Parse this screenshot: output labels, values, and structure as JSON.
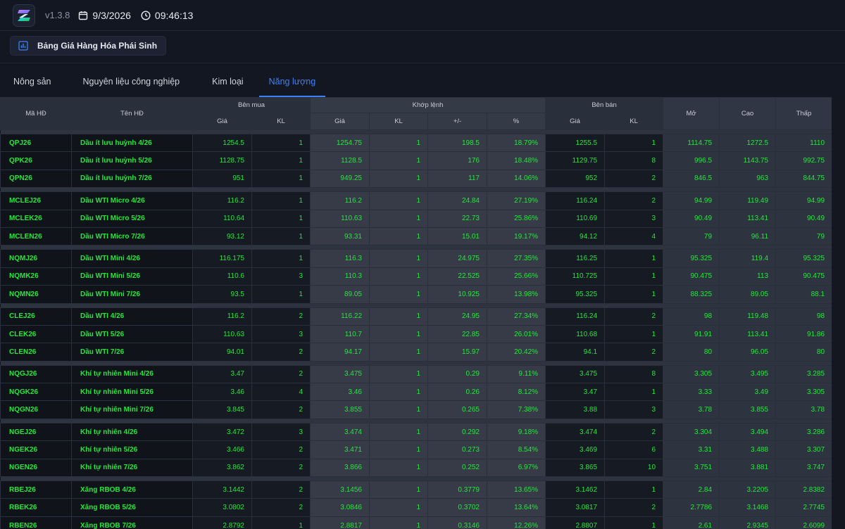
{
  "app": {
    "version": "v1.3.8",
    "date": "9/3/2026",
    "time": "09:46:13"
  },
  "title": "Bảng Giá Hàng Hóa Phái Sinh",
  "tabs": [
    "Nông sản",
    "Nguyên liệu công nghiệp",
    "Kim loại",
    "Năng lượng"
  ],
  "active_tab": 3,
  "headers": {
    "code": "Mã HĐ",
    "name": "Tên HĐ",
    "bid_group": "Bên mua",
    "match_group": "Khớp lệnh",
    "ask_group": "Bên bán",
    "open": "Mở",
    "high": "Cao",
    "low": "Thấp",
    "bid_price": "Giá",
    "bid_vol": "KL",
    "match_price": "Giá",
    "match_vol": "KL",
    "match_change": "+/-",
    "match_pct": "%",
    "ask_price": "Giá",
    "ask_vol": "KL"
  },
  "colors": {
    "accent": "#3b82f6",
    "up": "#22e83a",
    "bg": "#131722"
  },
  "groups": [
    [
      [
        "QPJ26",
        "Dầu ít lưu huỳnh 4/26",
        "1254.5",
        "1",
        "1254.75",
        "1",
        "198.5",
        "18.79%",
        "1255.5",
        "1",
        "1114.75",
        "1272.5",
        "1110"
      ],
      [
        "QPK26",
        "Dầu ít lưu huỳnh 5/26",
        "1128.75",
        "1",
        "1128.5",
        "1",
        "176",
        "18.48%",
        "1129.75",
        "8",
        "996.5",
        "1143.75",
        "992.75"
      ],
      [
        "QPN26",
        "Dầu ít lưu huỳnh 7/26",
        "951",
        "1",
        "949.25",
        "1",
        "117",
        "14.06%",
        "952",
        "2",
        "846.5",
        "963",
        "844.75"
      ]
    ],
    [
      [
        "MCLEJ26",
        "Dầu WTI Micro 4/26",
        "116.2",
        "1",
        "116.2",
        "1",
        "24.84",
        "27.19%",
        "116.24",
        "2",
        "94.99",
        "119.49",
        "94.99"
      ],
      [
        "MCLEK26",
        "Dầu WTI Micro 5/26",
        "110.64",
        "1",
        "110.63",
        "1",
        "22.73",
        "25.86%",
        "110.69",
        "3",
        "90.49",
        "113.41",
        "90.49"
      ],
      [
        "MCLEN26",
        "Dầu WTI Micro 7/26",
        "93.12",
        "1",
        "93.31",
        "1",
        "15.01",
        "19.17%",
        "94.12",
        "4",
        "79",
        "96.11",
        "79"
      ]
    ],
    [
      [
        "NQMJ26",
        "Dầu WTI Mini 4/26",
        "116.175",
        "1",
        "116.3",
        "1",
        "24.975",
        "27.35%",
        "116.25",
        "1",
        "95.325",
        "119.4",
        "95.325"
      ],
      [
        "NQMK26",
        "Dầu WTI Mini 5/26",
        "110.6",
        "3",
        "110.3",
        "1",
        "22.525",
        "25.66%",
        "110.725",
        "1",
        "90.475",
        "113",
        "90.475"
      ],
      [
        "NQMN26",
        "Dầu WTI Mini 7/26",
        "93.5",
        "1",
        "89.05",
        "1",
        "10.925",
        "13.98%",
        "95.325",
        "1",
        "88.325",
        "89.05",
        "88.1"
      ]
    ],
    [
      [
        "CLEJ26",
        "Dầu WTI 4/26",
        "116.2",
        "2",
        "116.22",
        "1",
        "24.95",
        "27.34%",
        "116.24",
        "2",
        "98",
        "119.48",
        "98"
      ],
      [
        "CLEK26",
        "Dầu WTI 5/26",
        "110.63",
        "3",
        "110.7",
        "1",
        "22.85",
        "26.01%",
        "110.68",
        "1",
        "91.91",
        "113.41",
        "91.86"
      ],
      [
        "CLEN26",
        "Dầu WTI 7/26",
        "94.01",
        "2",
        "94.17",
        "1",
        "15.97",
        "20.42%",
        "94.1",
        "2",
        "80",
        "96.05",
        "80"
      ]
    ],
    [
      [
        "NQGJ26",
        "Khí tự nhiên Mini 4/26",
        "3.47",
        "2",
        "3.475",
        "1",
        "0.29",
        "9.11%",
        "3.475",
        "8",
        "3.305",
        "3.495",
        "3.285"
      ],
      [
        "NQGK26",
        "Khí tự nhiên Mini 5/26",
        "3.46",
        "4",
        "3.46",
        "1",
        "0.26",
        "8.12%",
        "3.47",
        "1",
        "3.33",
        "3.49",
        "3.305"
      ],
      [
        "NQGN26",
        "Khí tự nhiên Mini 7/26",
        "3.845",
        "2",
        "3.855",
        "1",
        "0.265",
        "7.38%",
        "3.88",
        "3",
        "3.78",
        "3.855",
        "3.78"
      ]
    ],
    [
      [
        "NGEJ26",
        "Khí tự nhiên 4/26",
        "3.472",
        "3",
        "3.474",
        "1",
        "0.292",
        "9.18%",
        "3.474",
        "2",
        "3.304",
        "3.494",
        "3.286"
      ],
      [
        "NGEK26",
        "Khí tự nhiên 5/26",
        "3.466",
        "2",
        "3.471",
        "1",
        "0.273",
        "8.54%",
        "3.469",
        "6",
        "3.31",
        "3.488",
        "3.307"
      ],
      [
        "NGEN26",
        "Khí tự nhiên 7/26",
        "3.862",
        "2",
        "3.866",
        "1",
        "0.252",
        "6.97%",
        "3.865",
        "10",
        "3.751",
        "3.881",
        "3.747"
      ]
    ],
    [
      [
        "RBEJ26",
        "Xăng RBOB 4/26",
        "3.1442",
        "2",
        "3.1456",
        "1",
        "0.3779",
        "13.65%",
        "3.1462",
        "1",
        "2.84",
        "3.2205",
        "2.8382"
      ],
      [
        "RBEK26",
        "Xăng RBOB 5/26",
        "3.0802",
        "2",
        "3.0846",
        "1",
        "0.3702",
        "13.64%",
        "3.0817",
        "2",
        "2.7786",
        "3.1468",
        "2.7745"
      ],
      [
        "RBEN26",
        "Xăng RBOB 7/26",
        "2.8792",
        "1",
        "2.8817",
        "1",
        "0.3146",
        "12.26%",
        "2.8807",
        "1",
        "2.61",
        "2.9345",
        "2.6099"
      ]
    ]
  ]
}
